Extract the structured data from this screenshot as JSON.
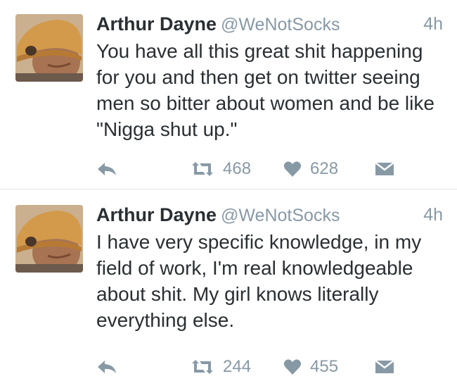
{
  "tweets": [
    {
      "author_name": "Arthur Dayne",
      "handle": "@WeNotSocks",
      "time": "4h",
      "text": "You have all this great shit happening for you and then get on twitter seeing men so bitter about women and be like \"Nigga shut up.\"",
      "retweets": "468",
      "likes": "628"
    },
    {
      "author_name": "Arthur Dayne",
      "handle": "@WeNotSocks",
      "time": "4h",
      "text": "I have very specific knowledge, in my field of work, I'm real knowledgeable about shit. My girl knows literally everything else.",
      "retweets": "244",
      "likes": "455"
    }
  ],
  "icons": {
    "reply": "reply-arrow-icon",
    "retweet": "retweet-icon",
    "like": "heart-icon",
    "dm": "envelope-icon"
  },
  "colors": {
    "text": "#292f33",
    "muted": "#8899a6",
    "divider": "#e1e8ed"
  }
}
